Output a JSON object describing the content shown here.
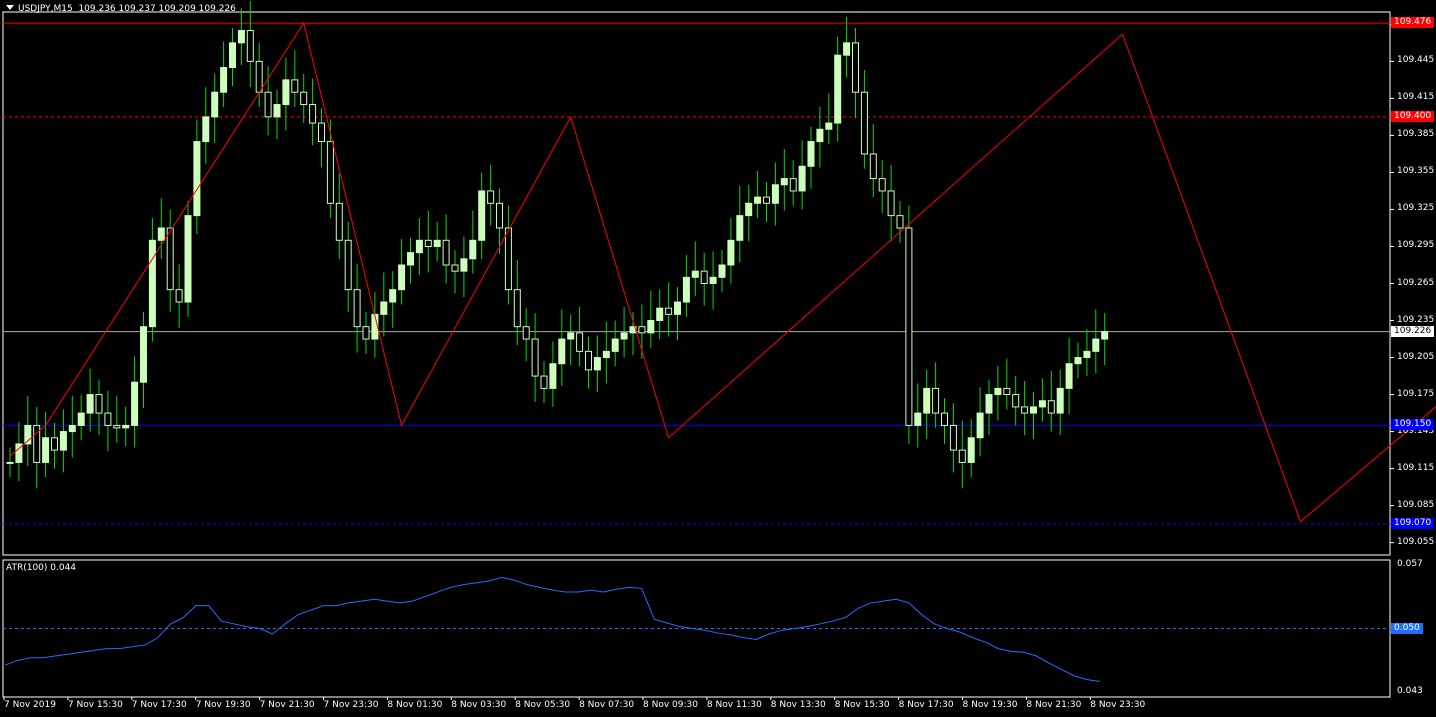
{
  "header": {
    "symbol": "USDJPY,M15",
    "quote": "109.236 109.237 109.209 109.226"
  },
  "indicator": {
    "label": "ATR(100) 0.044"
  },
  "colors": {
    "bull_candle": "#ccffbb",
    "wick": "#00dd00",
    "zigzag": "#ff0000",
    "atr": "#1e6fff",
    "level_red": "#ff0000",
    "level_blue": "#0000ff",
    "grid_axis": "#ffffff"
  },
  "price_axis": {
    "ticks": [
      "109.475",
      "109.445",
      "109.415",
      "109.385",
      "109.355",
      "109.325",
      "109.295",
      "109.265",
      "109.235",
      "109.205",
      "109.175",
      "109.145",
      "109.115",
      "109.085",
      "109.055"
    ],
    "tags": [
      {
        "value": "109.476",
        "bg": "#ff0000",
        "fg": "#ffffff",
        "price": 109.476
      },
      {
        "value": "109.400",
        "bg": "#ff0000",
        "fg": "#ffffff",
        "price": 109.4
      },
      {
        "value": "109.226",
        "bg": "#ffffff",
        "fg": "#000000",
        "price": 109.226
      },
      {
        "value": "109.150",
        "bg": "#0000ff",
        "fg": "#ffffff",
        "price": 109.15
      },
      {
        "value": "109.070",
        "bg": "#0000ff",
        "fg": "#ffffff",
        "price": 109.07
      }
    ]
  },
  "atr_axis": {
    "ticks": [
      "0.057",
      "0.050",
      "0.043"
    ],
    "tag": {
      "value": "0.050",
      "bg": "#1e6fff",
      "fg": "#ffffff"
    }
  },
  "time_axis": {
    "labels": [
      "7 Nov 2019",
      "7 Nov 15:30",
      "7 Nov 17:30",
      "7 Nov 19:30",
      "7 Nov 21:30",
      "7 Nov 23:30",
      "8 Nov 01:30",
      "8 Nov 03:30",
      "8 Nov 05:30",
      "8 Nov 07:30",
      "8 Nov 09:30",
      "8 Nov 11:30",
      "8 Nov 13:30",
      "8 Nov 15:30",
      "8 Nov 17:30",
      "8 Nov 19:30",
      "8 Nov 21:30",
      "8 Nov 23:30"
    ]
  },
  "chart_data": {
    "type": "candlestick",
    "symbol": "USDJPY",
    "timeframe": "M15",
    "ylim": [
      109.045,
      109.485
    ],
    "levels": [
      {
        "price": 109.476,
        "color": "red",
        "style": "solid"
      },
      {
        "price": 109.4,
        "color": "red",
        "style": "dashed"
      },
      {
        "price": 109.226,
        "color": "gray",
        "style": "solid"
      },
      {
        "price": 109.15,
        "color": "blue",
        "style": "solid"
      },
      {
        "price": 109.07,
        "color": "blue",
        "style": "dashed"
      }
    ],
    "zigzag": [
      [
        0,
        109.125
      ],
      [
        4,
        109.15
      ],
      [
        33,
        109.476
      ],
      [
        44,
        109.15
      ],
      [
        63,
        109.4
      ],
      [
        74,
        109.14
      ],
      [
        125,
        109.467
      ],
      [
        145,
        109.072
      ],
      [
        170,
        109.225
      ]
    ],
    "close_path": [
      109.12,
      109.135,
      109.15,
      109.12,
      109.14,
      109.13,
      109.145,
      109.15,
      109.16,
      109.175,
      109.16,
      109.15,
      109.148,
      109.15,
      109.185,
      109.23,
      109.3,
      109.31,
      109.26,
      109.25,
      109.32,
      109.38,
      109.4,
      109.42,
      109.44,
      109.46,
      109.47,
      109.445,
      109.42,
      109.4,
      109.41,
      109.43,
      109.42,
      109.41,
      109.395,
      109.38,
      109.33,
      109.3,
      109.26,
      109.23,
      109.22,
      109.24,
      109.25,
      109.26,
      109.28,
      109.29,
      109.3,
      109.295,
      109.3,
      109.28,
      109.275,
      109.285,
      109.3,
      109.34,
      109.33,
      109.31,
      109.26,
      109.23,
      109.22,
      109.19,
      109.18,
      109.2,
      109.22,
      109.225,
      109.21,
      109.195,
      109.205,
      109.21,
      109.22,
      109.225,
      109.23,
      109.225,
      109.235,
      109.245,
      109.24,
      109.25,
      109.27,
      109.275,
      109.265,
      109.27,
      109.28,
      109.3,
      109.32,
      109.33,
      109.335,
      109.33,
      109.345,
      109.35,
      109.34,
      109.36,
      109.38,
      109.39,
      109.395,
      109.45,
      109.46,
      109.42,
      109.37,
      109.35,
      109.34,
      109.32,
      109.31,
      109.15,
      109.16,
      109.18,
      109.16,
      109.15,
      109.13,
      109.12,
      109.14,
      109.16,
      109.175,
      109.18,
      109.175,
      109.165,
      109.16,
      109.165,
      109.17,
      109.16,
      109.18,
      109.2,
      109.205,
      109.21,
      109.22,
      109.226
    ],
    "atr_values": [
      0.046,
      0.0465,
      0.0468,
      0.0468,
      0.047,
      0.0472,
      0.0474,
      0.0476,
      0.0478,
      0.0478,
      0.048,
      0.0482,
      0.049,
      0.0505,
      0.0512,
      0.0525,
      0.0525,
      0.0508,
      0.0505,
      0.0502,
      0.05,
      0.0494,
      0.0505,
      0.0515,
      0.052,
      0.0525,
      0.0525,
      0.0528,
      0.053,
      0.0532,
      0.053,
      0.0528,
      0.053,
      0.0535,
      0.054,
      0.0545,
      0.0548,
      0.055,
      0.0552,
      0.0556,
      0.0553,
      0.0548,
      0.0545,
      0.0542,
      0.054,
      0.054,
      0.0542,
      0.054,
      0.0543,
      0.0545,
      0.0544,
      0.051,
      0.0506,
      0.0502,
      0.05,
      0.0498,
      0.0495,
      0.0493,
      0.049,
      0.0488,
      0.0494,
      0.0498,
      0.05,
      0.0502,
      0.0505,
      0.0508,
      0.0512,
      0.0522,
      0.0528,
      0.053,
      0.0532,
      0.0528,
      0.0515,
      0.0505,
      0.05,
      0.0496,
      0.049,
      0.0485,
      0.0478,
      0.0475,
      0.0474,
      0.047,
      0.0462,
      0.0455,
      0.0448,
      0.0444,
      0.0442
    ]
  }
}
